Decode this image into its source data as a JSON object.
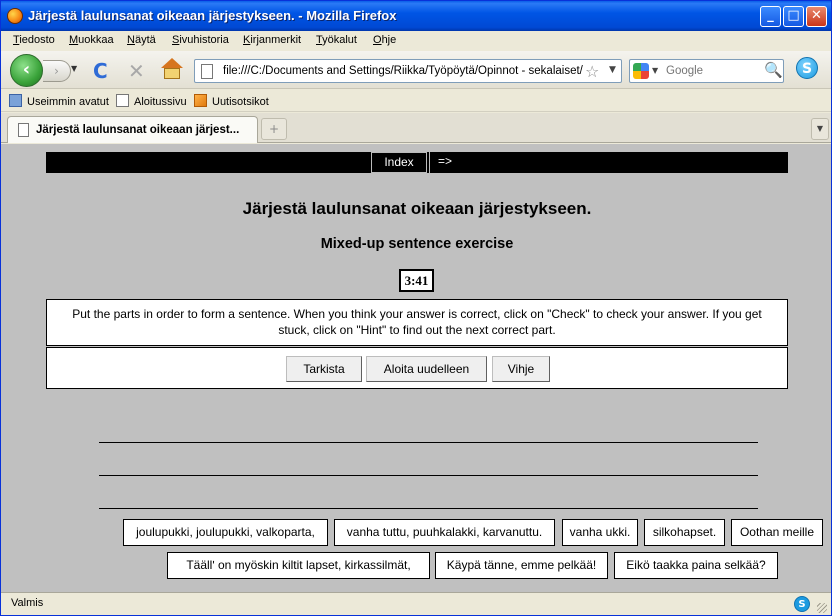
{
  "window": {
    "title": "Järjestä laulunsanat oikeaan järjestykseen. - Mozilla Firefox",
    "minimize": "_",
    "maximize": "□",
    "close": "✕"
  },
  "menu": [
    "Tiedosto",
    "Muokkaa",
    "Näytä",
    "Sivuhistoria",
    "Kirjanmerkit",
    "Työkalut",
    "Ohje"
  ],
  "toolbar": {
    "back": "‹",
    "forward": "›",
    "history_drop": "▼",
    "reload": "C",
    "stop": "✕",
    "url": "file:///C:/Documents and Settings/Riikka/Työpöytä/Opinnot - sekalaiset/Ko",
    "star": "☆",
    "url_drop": "▼",
    "search_engine_drop": "▼",
    "search_placeholder": "Google",
    "search_go": "🔍",
    "skype": "S"
  },
  "bookmarks": [
    "Useimmin avatut",
    "Aloitussivu",
    "Uutisotsikot"
  ],
  "tabs": {
    "active_title": "Järjestä laulunsanat oikeaan järjest...",
    "new_tab": "+",
    "list": "▼"
  },
  "exercise": {
    "nav_index": "Index",
    "nav_next": "=>",
    "title": "Järjestä laulunsanat oikeaan järjestykseen.",
    "subtitle": "Mixed-up sentence exercise",
    "timer": "3:41",
    "instructions": "Put the parts in order to form a sentence. When you think your answer is correct, click on \"Check\" to check your answer. If you get stuck, click on \"Hint\" to find out the next correct part.",
    "buttons": [
      "Tarkista",
      "Aloita uudelleen",
      "Vihje"
    ],
    "chips_row1": [
      "joulupukki, joulupukki, valkoparta,",
      "vanha tuttu, puuhkalakki, karvanuttu.",
      "vanha ukki.",
      "silkohapset.",
      "Oothan meille"
    ],
    "chips_row2": [
      "Täällʹ on myöskin kiltit lapset, kirkassilmät,",
      "Käypä tänne, emme pelkää!",
      "Eikö taakka paina selkää?"
    ]
  },
  "status": {
    "text": "Valmis",
    "skype": "S"
  },
  "colors": {
    "titlebar": "#0055e5",
    "content_bg": "#c0c0c0",
    "nav_strip": "#000000"
  }
}
